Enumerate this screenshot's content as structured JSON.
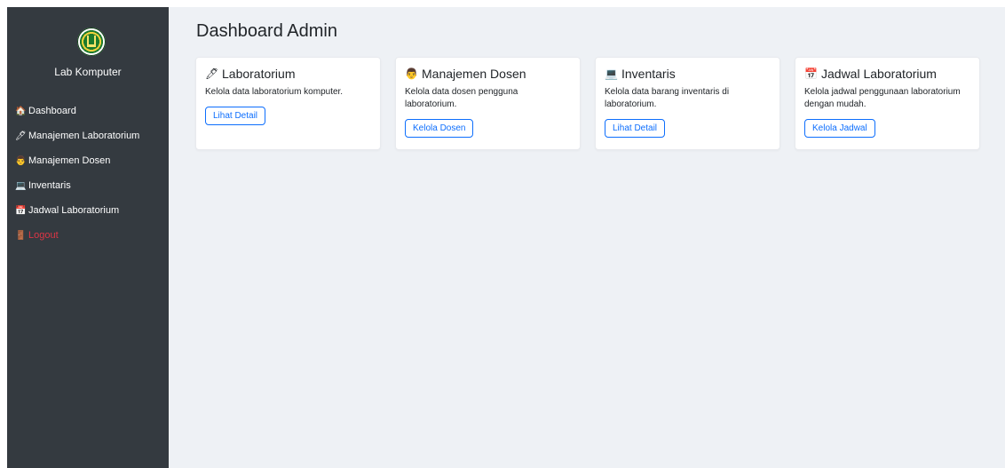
{
  "sidebar": {
    "app_title": "Lab Komputer",
    "items": [
      {
        "icon": "house-icon",
        "glyph": "🏠",
        "label": "Dashboard"
      },
      {
        "icon": "pencil-icon",
        "glyph": "🖊",
        "label": "Manajemen Laboratorium"
      },
      {
        "icon": "teacher-icon",
        "glyph": "👨",
        "label": "Manajemen Dosen"
      },
      {
        "icon": "laptop-icon",
        "glyph": "💻",
        "label": "Inventaris"
      },
      {
        "icon": "calendar-icon",
        "glyph": "📅",
        "label": "Jadwal Laboratorium"
      },
      {
        "icon": "door-icon",
        "glyph": "🚪",
        "label": "Logout"
      }
    ]
  },
  "main": {
    "title": "Dashboard Admin",
    "cards": [
      {
        "icon": "pencil-icon",
        "glyph": "🖊",
        "title": "Laboratorium",
        "text": "Kelola data laboratorium komputer.",
        "button": "Lihat Detail"
      },
      {
        "icon": "teacher-icon",
        "glyph": "👨",
        "title": "Manajemen Dosen",
        "text": "Kelola data dosen pengguna laboratorium.",
        "button": "Kelola Dosen"
      },
      {
        "icon": "laptop-icon",
        "glyph": "💻",
        "title": "Inventaris",
        "text": "Kelola data barang inventaris di laboratorium.",
        "button": "Lihat Detail"
      },
      {
        "icon": "calendar-icon",
        "glyph": "📅",
        "title": "Jadwal Laboratorium",
        "text": "Kelola jadwal penggunaan laboratorium dengan mudah.",
        "button": "Kelola Jadwal"
      }
    ]
  },
  "colors": {
    "sidebar_bg": "#343a40",
    "main_bg": "#eef1f5",
    "accent": "#0d6efd",
    "danger": "#dc3545"
  }
}
